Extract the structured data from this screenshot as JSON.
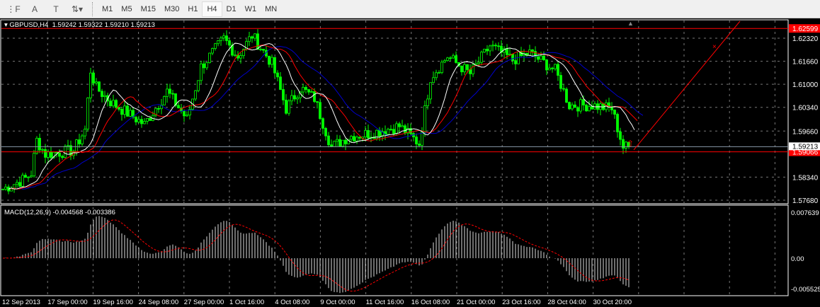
{
  "toolbar": {
    "icons": [
      "grid-f-icon",
      "text-a-icon",
      "text-label-icon",
      "arrows-icon"
    ],
    "timeframes": [
      "M1",
      "M5",
      "M15",
      "M30",
      "H1",
      "H4",
      "D1",
      "W1",
      "MN"
    ],
    "active": "H4"
  },
  "header": {
    "symbol": "GBPUSD,H4",
    "ohlc": "1.59242 1.59322 1.59210 1.59213"
  },
  "macd": {
    "label": "MACD(12,26,9) -0.004568 -0.003386",
    "axis": [
      "0.007639",
      "0.00",
      "-0.005525"
    ]
  },
  "price_axis": [
    "1.62320",
    "1.61660",
    "1.61000",
    "1.60340",
    "1.59660",
    "1.58340",
    "1.57680"
  ],
  "levels": {
    "upper": "1.62599",
    "lower": "1.59066",
    "bid": "1.59213"
  },
  "time_axis": [
    "12 Sep 2013",
    "17 Sep 00:00",
    "19 Sep 16:00",
    "24 Sep 08:00",
    "27 Sep 00:00",
    "1 Oct 16:00",
    "4 Oct 08:00",
    "9 Oct 00:00",
    "11 Oct 16:00",
    "16 Oct 08:00",
    "21 Oct 00:00",
    "23 Oct 16:00",
    "28 Oct 04:00",
    "30 Oct 20:00"
  ],
  "colors": {
    "bull": "#00ff00",
    "red": "#ff0000",
    "blue": "#0000cc",
    "white": "#ffffff"
  },
  "chart_data": {
    "type": "candlestick",
    "symbol": "GBPUSD",
    "timeframe": "H4",
    "bars": 222,
    "close_keypoints": [
      [
        0,
        1.58
      ],
      [
        8,
        1.583
      ],
      [
        10,
        1.5845
      ],
      [
        12,
        1.594
      ],
      [
        15,
        1.59
      ],
      [
        25,
        1.591
      ],
      [
        29,
        1.597
      ],
      [
        31,
        1.614
      ],
      [
        33,
        1.609
      ],
      [
        38,
        1.605
      ],
      [
        50,
        1.5985
      ],
      [
        58,
        1.608
      ],
      [
        65,
        1.6
      ],
      [
        70,
        1.615
      ],
      [
        78,
        1.623
      ],
      [
        83,
        1.618
      ],
      [
        88,
        1.624
      ],
      [
        95,
        1.616
      ],
      [
        100,
        1.603
      ],
      [
        105,
        1.609
      ],
      [
        110,
        1.606
      ],
      [
        116,
        1.592
      ],
      [
        122,
        1.595
      ],
      [
        130,
        1.596
      ],
      [
        140,
        1.598
      ],
      [
        147,
        1.593
      ],
      [
        151,
        1.612
      ],
      [
        157,
        1.618
      ],
      [
        165,
        1.613
      ],
      [
        172,
        1.621
      ],
      [
        180,
        1.617
      ],
      [
        186,
        1.619
      ],
      [
        195,
        1.614
      ],
      [
        200,
        1.604
      ],
      [
        208,
        1.604
      ],
      [
        215,
        1.603
      ],
      [
        219,
        1.592
      ],
      [
        221,
        1.5921
      ]
    ]
  }
}
